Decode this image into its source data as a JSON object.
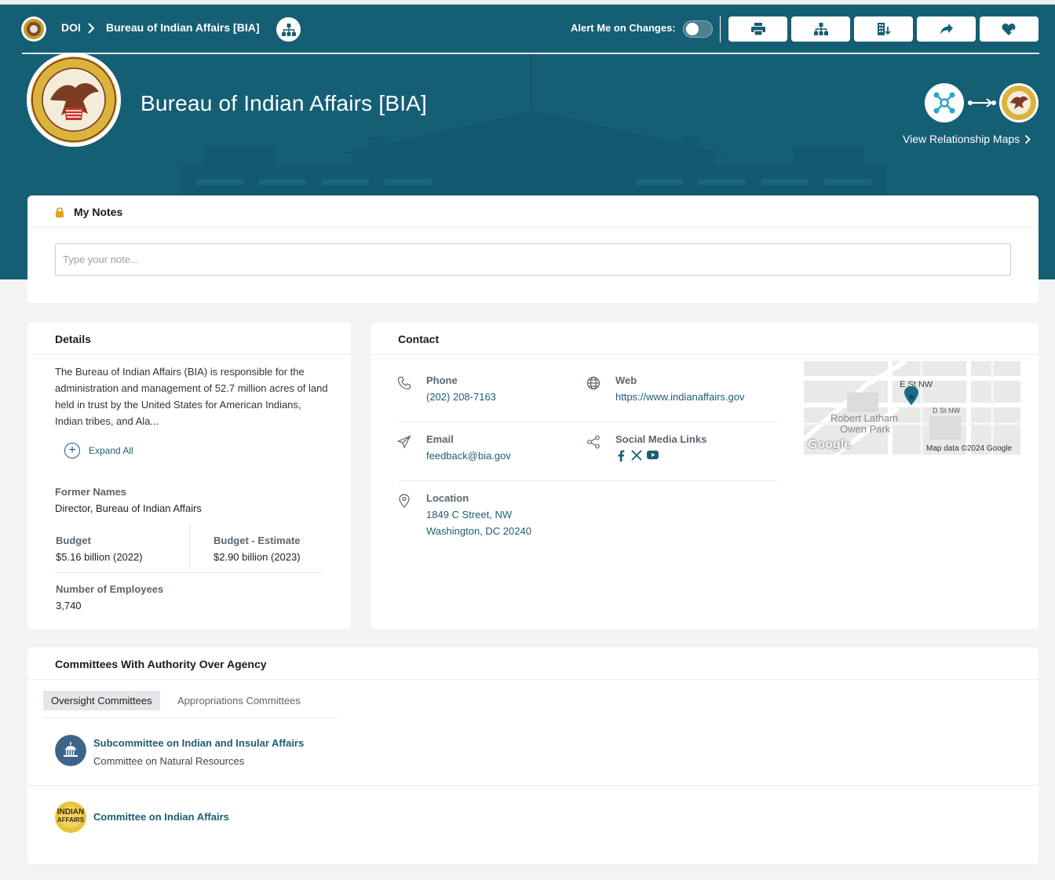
{
  "breadcrumb": {
    "root": "DOI",
    "current": "Bureau of Indian Affairs [BIA]"
  },
  "alert": {
    "label": "Alert Me on Changes:",
    "enabled": false
  },
  "toolbar": {
    "buttons": [
      "printer-icon",
      "org-chart-icon",
      "building-download-icon",
      "share-icon",
      "heart-plus-icon"
    ]
  },
  "header": {
    "title": "Bureau of Indian Affairs [BIA]",
    "relationship_link": "View Relationship Maps"
  },
  "notes": {
    "title": "My Notes",
    "placeholder": "Type your note..."
  },
  "details": {
    "title": "Details",
    "description": "The Bureau of Indian Affairs (BIA) is responsible for the administration and management of 52.7 million acres of land held in trust by the United States for American Indians, Indian tribes, and Ala...",
    "expand_label": "Expand All",
    "former_names_label": "Former Names",
    "former_names_value": "Director, Bureau of Indian Affairs",
    "budget_label": "Budget",
    "budget_value": "$5.16 billion (2022)",
    "budget_est_label": "Budget - Estimate",
    "budget_est_value": "$2.90 billion (2023)",
    "employees_label": "Number of Employees",
    "employees_value": "3,740"
  },
  "contact": {
    "title": "Contact",
    "phone_label": "Phone",
    "phone_value": "(202) 208-7163",
    "web_label": "Web",
    "web_value": "https://www.indianaffairs.gov",
    "email_label": "Email",
    "email_value": "feedback@bia.gov",
    "social_label": "Social Media Links",
    "location_label": "Location",
    "location_line1": "1849 C Street, NW",
    "location_line2": "Washington, DC 20240",
    "map": {
      "street1": "E St NW",
      "street2": "D St NW",
      "park": "Robert Latham",
      "park2": "Owen Park",
      "brand": "Google",
      "attribution": "Map data ©2024 Google"
    }
  },
  "committees": {
    "title": "Committees With Authority Over Agency",
    "tabs": [
      {
        "label": "Oversight Committees",
        "active": true
      },
      {
        "label": "Appropriations Committees",
        "active": false
      }
    ],
    "items": [
      {
        "name": "Subcommittee on Indian and Insular Affairs",
        "parent": "Committee on Natural Resources"
      },
      {
        "name": "Committee on Indian Affairs",
        "parent": ""
      }
    ],
    "logo_text": {
      "line1": "INDIAN",
      "line2": "AFFAIRS"
    }
  },
  "colors": {
    "brand": "#155f75",
    "link": "#1f5c73",
    "gold": "#e8c43a"
  }
}
